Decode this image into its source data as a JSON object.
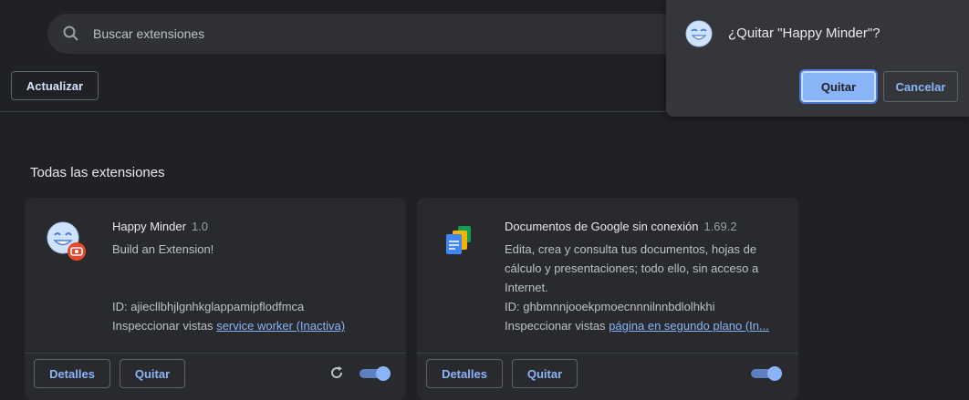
{
  "search": {
    "placeholder": "Buscar extensiones"
  },
  "toolbar": {
    "update_label": "Actualizar"
  },
  "section": {
    "title": "Todas las extensiones"
  },
  "extensions": [
    {
      "name": "Happy Minder",
      "version": "1.0",
      "description": "Build an Extension!",
      "id_text": "ID: ajiecllbhjlgnhkglappamipflodfmca",
      "inspect_label": "Inspeccionar vistas",
      "inspect_link": "service worker (Inactiva)",
      "details_label": "Detalles",
      "remove_label": "Quitar",
      "enabled": true
    },
    {
      "name": "Documentos de Google sin conexión",
      "version": "1.69.2",
      "description": "Edita, crea y consulta tus documentos, hojas de cálculo y presentaciones; todo ello, sin acceso a Internet.",
      "id_text": "ID: ghbmnnjooekpmoecnnnilnnbdlolhkhi",
      "inspect_label": "Inspeccionar vistas",
      "inspect_link": "página en segundo plano (In...",
      "details_label": "Detalles",
      "remove_label": "Quitar",
      "enabled": true
    }
  ],
  "dialog": {
    "title": "¿Quitar \"Happy Minder\"?",
    "confirm_label": "Quitar",
    "cancel_label": "Cancelar"
  },
  "colors": {
    "background": "#202124",
    "card": "#292a2d",
    "accent": "#8ab4f8",
    "toggle_on": "#8ab4f8"
  },
  "icons": [
    "search-icon",
    "smiley-icon",
    "record-badge-icon",
    "google-docs-icon",
    "reload-icon"
  ]
}
